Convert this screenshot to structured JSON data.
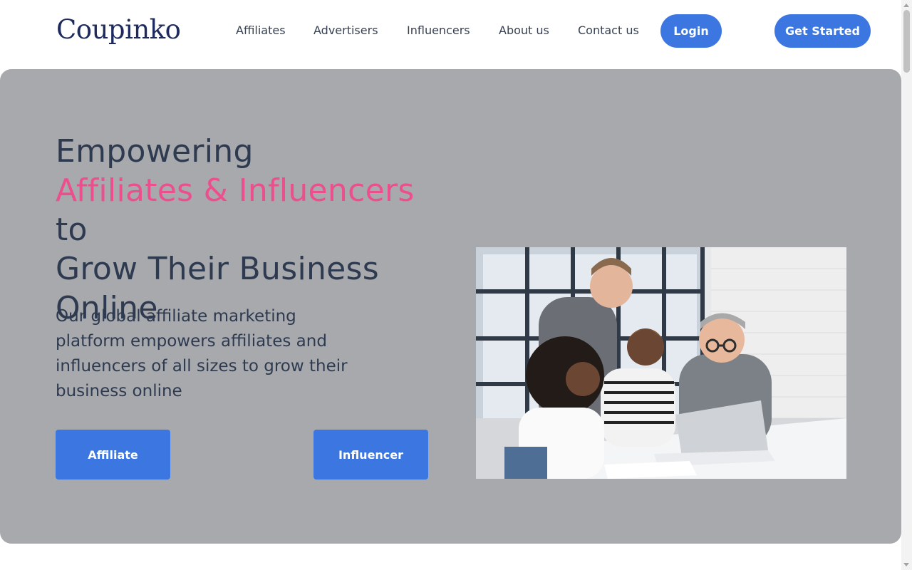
{
  "header": {
    "logo": "Coupinko",
    "nav": [
      "Affiliates",
      "Advertisers",
      "Influencers",
      "About us",
      "Contact us"
    ],
    "login_label": "Login",
    "get_started_label": "Get Started"
  },
  "hero": {
    "title_line1": "Empowering",
    "title_accent": "Affiliates & Influencers",
    "title_after_accent": " to",
    "title_line3": "Grow Their Business",
    "title_line4": "Online",
    "description": "Our global affiliate marketing platform empowers affiliates and influencers of all sizes to grow their business online",
    "affiliate_label": "Affiliate",
    "influencer_label": "Influencer",
    "photo_icon": "team-working-at-laptop-photo"
  },
  "colors": {
    "brand_blue": "#3b76e1",
    "accent_pink": "#ec4f8d",
    "hero_bg": "#a8a9ad",
    "text_dark": "#2e3a4f",
    "logo_navy": "#1d2a5e"
  }
}
